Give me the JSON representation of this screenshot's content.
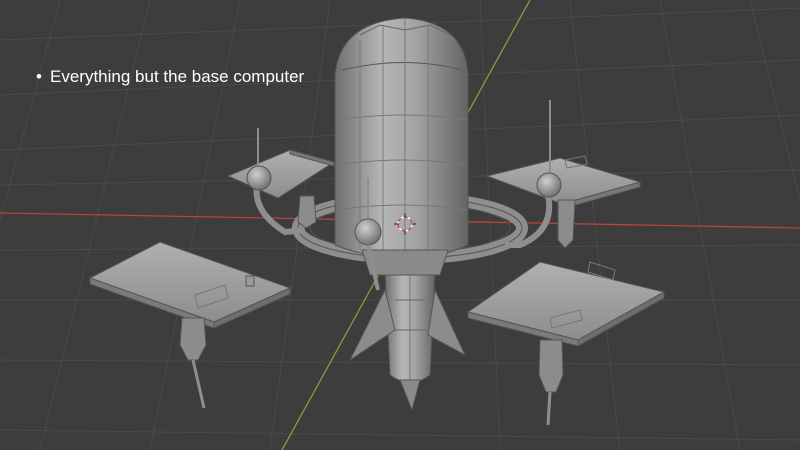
{
  "slide": {
    "bullets": [
      "Everything but the base computer"
    ]
  },
  "viewport": {
    "background_color": "#3d3d3d",
    "grid_color": "#4a4a4a",
    "x_axis_color": "#b8433f",
    "y_axis_color": "#7fa13a",
    "model_color": "#9b9b9b"
  }
}
